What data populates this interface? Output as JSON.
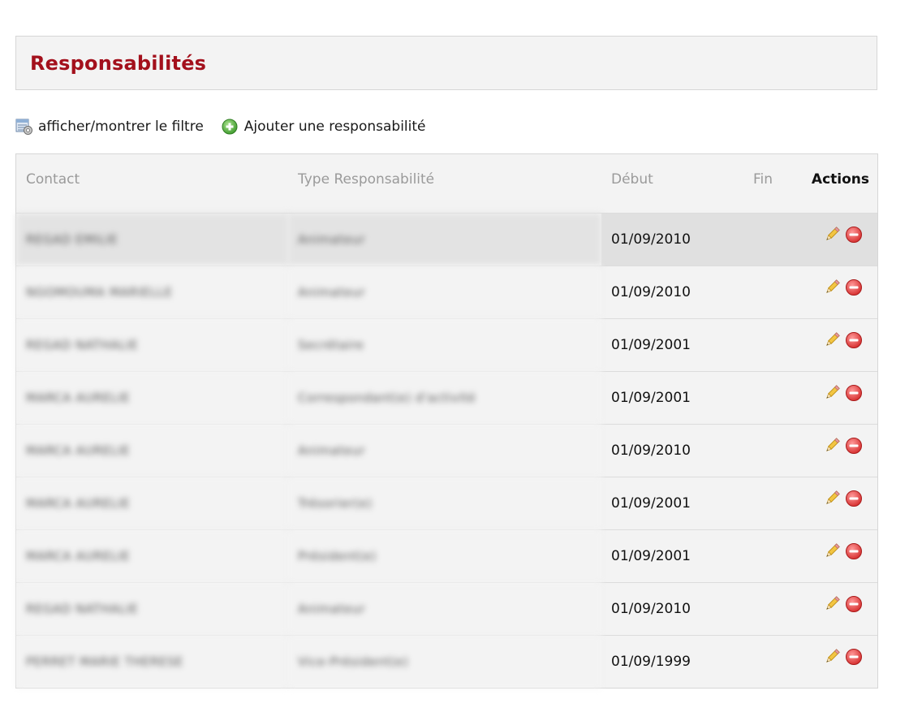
{
  "page": {
    "title": "Responsabilités"
  },
  "toolbar": {
    "filter_label": "afficher/montrer le filtre",
    "filter_icon": "filter-icon",
    "add_label": "Ajouter une responsabilité",
    "add_icon": "add-circle-icon"
  },
  "table": {
    "headers": {
      "contact": "Contact",
      "type": "Type Responsabilité",
      "debut": "Début",
      "fin": "Fin",
      "actions": "Actions"
    },
    "rows": [
      {
        "contact": "REGAD EMILIE",
        "type": "Animateur",
        "debut": "01/09/2010",
        "fin": ""
      },
      {
        "contact": "NGOMOUMA MARIELLE",
        "type": "Animateur",
        "debut": "01/09/2010",
        "fin": ""
      },
      {
        "contact": "REGAD NATHALIE",
        "type": "Secrétaire",
        "debut": "01/09/2001",
        "fin": ""
      },
      {
        "contact": "MARCA AURELIE",
        "type": "Correspondant(e) d'activité",
        "debut": "01/09/2001",
        "fin": ""
      },
      {
        "contact": "MARCA AURELIE",
        "type": "Animateur",
        "debut": "01/09/2010",
        "fin": ""
      },
      {
        "contact": "MARCA AURELIE",
        "type": "Trésorier(e)",
        "debut": "01/09/2001",
        "fin": ""
      },
      {
        "contact": "MARCA AURELIE",
        "type": "Président(e)",
        "debut": "01/09/2001",
        "fin": ""
      },
      {
        "contact": "REGAD NATHALIE",
        "type": "Animateur",
        "debut": "01/09/2010",
        "fin": ""
      },
      {
        "contact": "PERRET MARIE THERESE",
        "type": "Vice-Président(e)",
        "debut": "01/09/1999",
        "fin": ""
      }
    ],
    "row_actions": {
      "edit_icon": "pencil-edit-icon",
      "delete_icon": "delete-circle-icon"
    }
  },
  "colors": {
    "title": "#a3101c",
    "panel_bg": "#f3f3f3",
    "border": "#d6d6d6",
    "highlight_row": "#e3e3e3",
    "header_muted": "#9a9a9a"
  }
}
